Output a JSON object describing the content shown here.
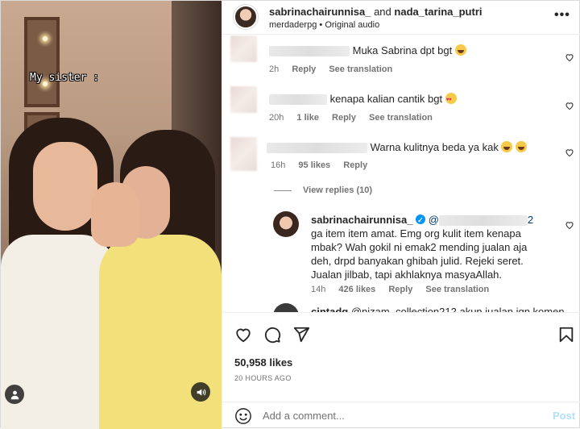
{
  "media": {
    "overlay_text": "My sister :"
  },
  "header": {
    "username1": "sabrinachairunnisa_",
    "joiner": "and",
    "username2": "nada_tarina_putri",
    "audio_user": "merdaderpg",
    "audio_sep": "•",
    "audio_label": "Original audio",
    "more_glyph": "•••"
  },
  "comments": [
    {
      "text": "Muka Sabrina dpt bgt",
      "time": "2h",
      "likes": "",
      "reply": "Reply",
      "translate": "See translation"
    },
    {
      "text": "kenapa kalian cantik bgt",
      "time": "20h",
      "likes": "1 like",
      "reply": "Reply",
      "translate": "See translation"
    },
    {
      "text": "Warna kulitnya beda ya kak",
      "time": "16h",
      "likes": "95 likes",
      "reply": "Reply",
      "translate": ""
    }
  ],
  "view_replies": "View replies (10)",
  "reply": {
    "username": "sabrinachairunnisa_",
    "mention_start": "@",
    "mention_end": "2",
    "text": "ga item item amat. Emg org kulit item kenapa mbak? Wah gokil ni emak2 mending jualan aja deh, drpd banyakan ghibah julid. Rejeki seret. Jualan jilbab, tapi akhlaknya masyaAllah.",
    "time": "14h",
    "likes": "426 likes",
    "reply_label": "Reply",
    "translate": "See translation"
  },
  "partial_comment": {
    "username": "cintadg",
    "text": "@nizam_collection212 akun jualan jgn komen"
  },
  "actions": {
    "likes": "50,958 likes",
    "date": "20 HOURS AGO"
  },
  "add_comment": {
    "placeholder": "Add a comment...",
    "post_label": "Post",
    "post_color": "#b2dffc"
  },
  "icons": [
    "user-icon",
    "volume-icon",
    "heart-icon",
    "comment-icon",
    "share-icon",
    "bookmark-icon",
    "smile-icon",
    "more-icon",
    "verified-icon"
  ]
}
